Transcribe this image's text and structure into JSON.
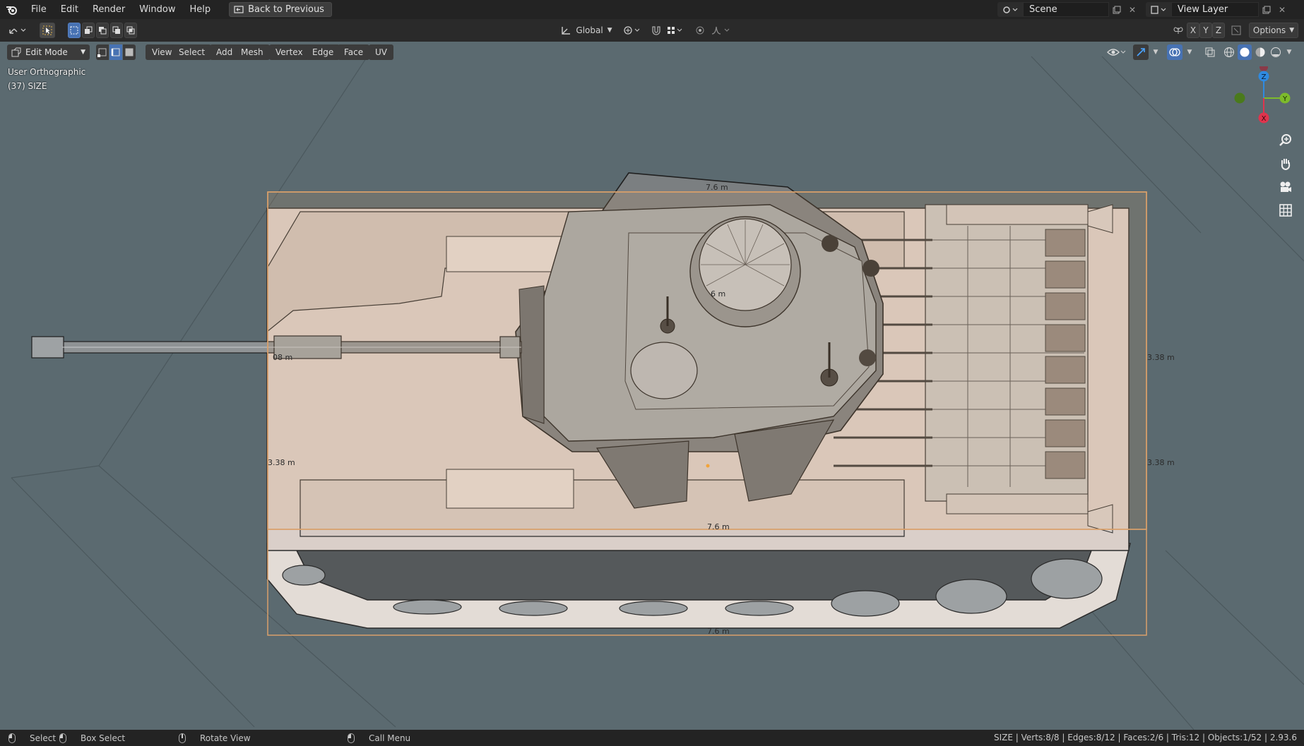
{
  "topbar": {
    "menu": [
      "File",
      "Edit",
      "Render",
      "Window",
      "Help"
    ],
    "back_button": "Back to Previous",
    "scene": "Scene",
    "view_layer": "View Layer"
  },
  "toolheader": {
    "orientation": "Global",
    "axes": [
      "X",
      "Y",
      "Z"
    ],
    "options": "Options"
  },
  "viewport_header": {
    "mode": "Edit Mode",
    "menus": [
      "View",
      "Select",
      "Add",
      "Mesh",
      "Vertex",
      "Edge",
      "Face",
      "UV"
    ]
  },
  "viewport": {
    "view_name": "User Orthographic",
    "object_info": "(37) SIZE",
    "gizmo": {
      "z": "Z",
      "y": "Y",
      "x": "X"
    },
    "dimensions": {
      "top_front": "7.6 m",
      "turret_inner": "6 m",
      "barrel_near": "08 m",
      "left_side": "3.38 m",
      "bottom_inner": "7.6 m",
      "bottom_outer": "7.6 m",
      "right_upper": "3.38 m",
      "right_lower": "3.38 m"
    }
  },
  "statusbar": {
    "select": "Select",
    "box_select": "Box Select",
    "rotate": "Rotate View",
    "call_menu": "Call Menu",
    "stats": "SIZE | Verts:8/8 | Edges:8/12 | Faces:2/6 | Tris:12 | Objects:1/52 | 2.93.6"
  },
  "colors": {
    "viewport_bg": "#5b6a70",
    "selection_box": "#d9a06a",
    "active_blue": "#4772b3",
    "axis_x": "#e0344d",
    "axis_y": "#7dbb2b",
    "axis_z": "#2f8ae0"
  }
}
